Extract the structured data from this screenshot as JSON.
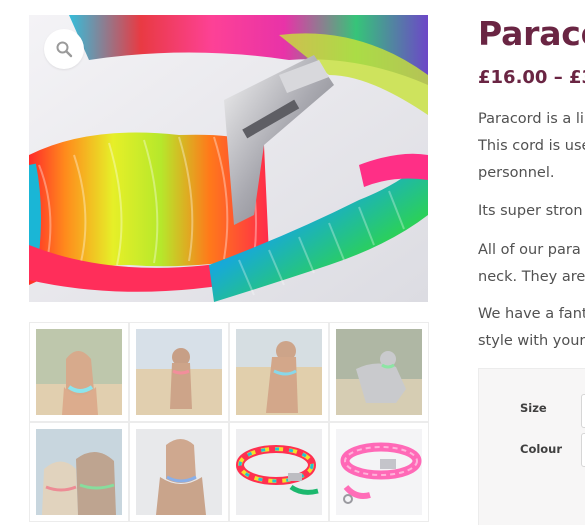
{
  "product": {
    "title": "Paraco",
    "price": "£16.00 – £3.",
    "description": [
      "Paracord is a li",
      "This cord is use",
      "personnel.",
      "Its super stron",
      "All of our para",
      "neck. They are",
      "We have a fant",
      "style with your"
    ]
  },
  "variations": {
    "size_label": "Size",
    "colour_label": "Colour"
  },
  "gallery": {
    "zoom_icon": "magnifier-icon",
    "thumbnails": [
      "dog-photo",
      "dog-photo",
      "dog-photo",
      "dog-photo",
      "dog-photo",
      "dog-photo",
      "rainbow-collar-photo",
      "pink-collar-photo"
    ]
  },
  "colors": {
    "title": "#6a2543",
    "text": "#515151"
  }
}
